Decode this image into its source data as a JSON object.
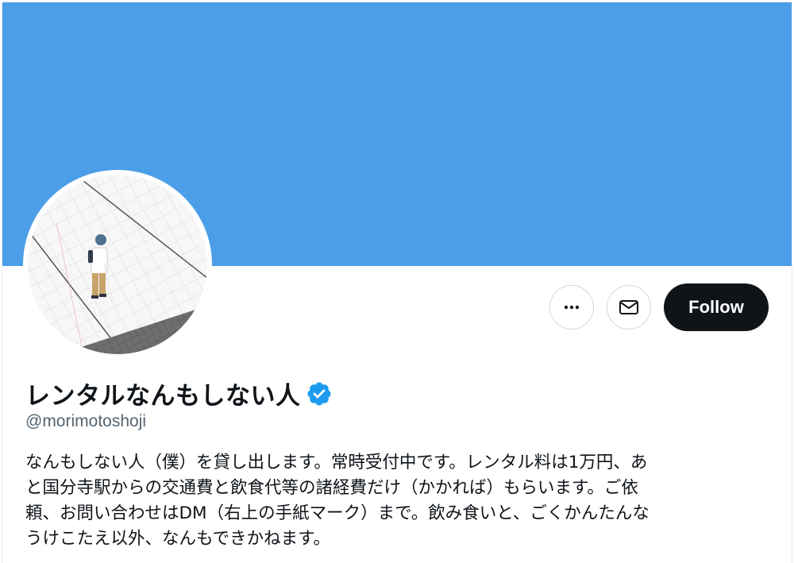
{
  "profile": {
    "banner_color": "#4c9ee8",
    "display_name": "レンタルなんもしない人",
    "handle": "@morimotoshoji",
    "verified": true,
    "verified_color": "#1d9bf0",
    "bio_lines": [
      "なんもしない人（僕）を貸し出します。常時受付中です。レンタル料は1万円、あ",
      "と国分寺駅からの交通費と飲食代等の諸経費だけ（かかれば）もらいます。ご依",
      "頼、お問い合わせはDM（右上の手紙マーク）まで。飲み食いと、ごくかんたんな",
      "うけこたえ以外、なんもできかねます。"
    ]
  },
  "actions": {
    "more_icon": "more-horizontal-icon",
    "message_icon": "envelope-icon",
    "follow_label": "Follow"
  }
}
